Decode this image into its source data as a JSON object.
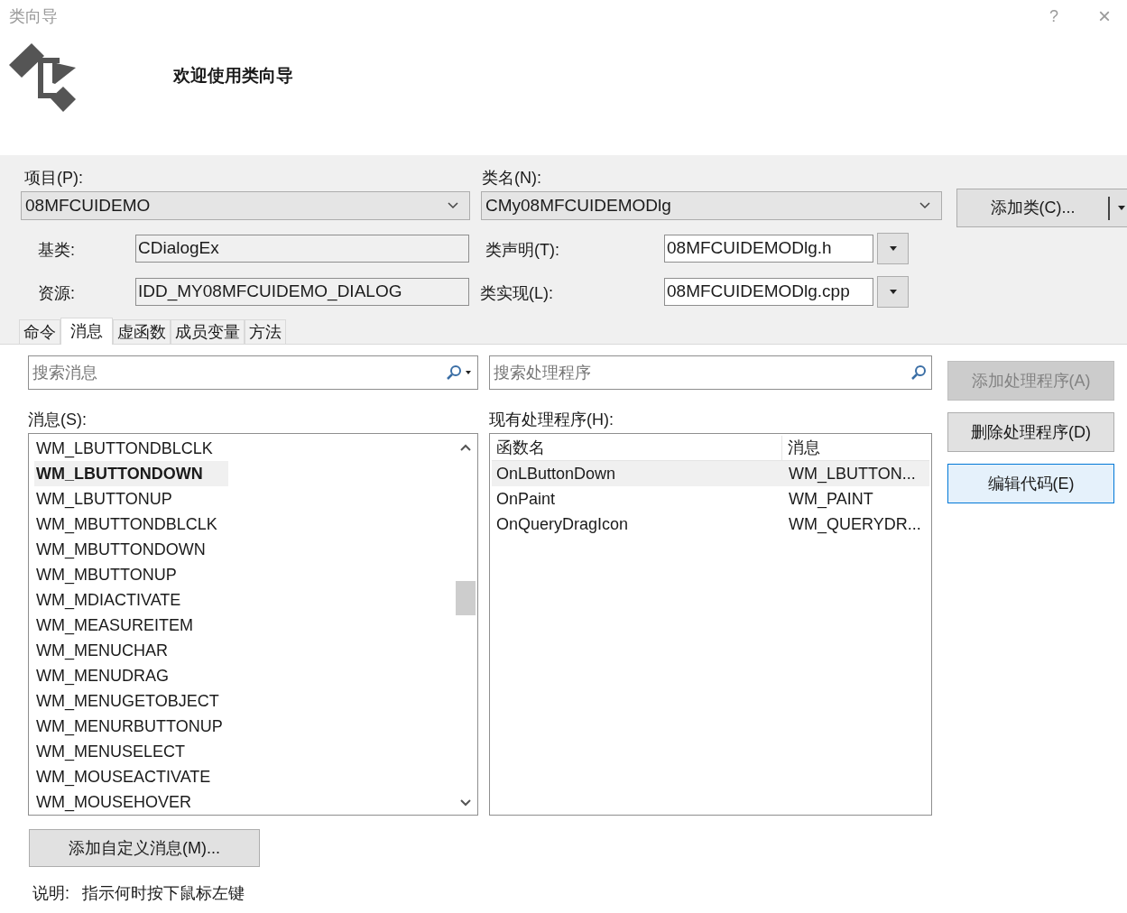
{
  "window": {
    "title": "类向导",
    "help": "?",
    "close": "×"
  },
  "header": {
    "welcome": "欢迎使用类向导"
  },
  "project": {
    "label": "项目(P):",
    "value": "08MFCUIDEMO"
  },
  "class_name": {
    "label": "类名(N):",
    "value": "CMy08MFCUIDEMODlg"
  },
  "add_class_button": {
    "label": "添加类(C)..."
  },
  "base_class": {
    "label": "基类:",
    "value": "CDialogEx"
  },
  "resource": {
    "label": "资源:",
    "value": "IDD_MY08MFCUIDEMO_DIALOG"
  },
  "class_declaration": {
    "label": "类声明(T):",
    "value": "08MFCUIDEMODlg.h"
  },
  "class_implementation": {
    "label": "类实现(L):",
    "value": "08MFCUIDEMODlg.cpp"
  },
  "tabs": [
    {
      "label": "命令",
      "selected": false
    },
    {
      "label": "消息",
      "selected": true
    },
    {
      "label": "虚函数",
      "selected": false
    },
    {
      "label": "成员变量",
      "selected": false
    },
    {
      "label": "方法",
      "selected": false
    }
  ],
  "message_search": {
    "placeholder": "搜索消息"
  },
  "handler_search": {
    "placeholder": "搜索处理程序"
  },
  "messages": {
    "label": "消息(S):",
    "items": [
      {
        "text": "WM_LBUTTONDBLCLK",
        "selected": false
      },
      {
        "text": "WM_LBUTTONDOWN",
        "selected": true
      },
      {
        "text": "WM_LBUTTONUP",
        "selected": false
      },
      {
        "text": "WM_MBUTTONDBLCLK",
        "selected": false
      },
      {
        "text": "WM_MBUTTONDOWN",
        "selected": false
      },
      {
        "text": "WM_MBUTTONUP",
        "selected": false
      },
      {
        "text": "WM_MDIACTIVATE",
        "selected": false
      },
      {
        "text": "WM_MEASUREITEM",
        "selected": false
      },
      {
        "text": "WM_MENUCHAR",
        "selected": false
      },
      {
        "text": "WM_MENUDRAG",
        "selected": false
      },
      {
        "text": "WM_MENUGETOBJECT",
        "selected": false
      },
      {
        "text": "WM_MENURBUTTONUP",
        "selected": false
      },
      {
        "text": "WM_MENUSELECT",
        "selected": false
      },
      {
        "text": "WM_MOUSEACTIVATE",
        "selected": false
      },
      {
        "text": "WM_MOUSEHOVER",
        "selected": false
      }
    ]
  },
  "handlers": {
    "label": "现有处理程序(H):",
    "columns": [
      "函数名",
      "消息"
    ],
    "rows": [
      {
        "cells": [
          "OnLButtonDown",
          "WM_LBUTTON..."
        ],
        "selected": true
      },
      {
        "cells": [
          "OnPaint",
          "WM_PAINT"
        ],
        "selected": false
      },
      {
        "cells": [
          "OnQueryDragIcon",
          "WM_QUERYDR..."
        ],
        "selected": false
      }
    ]
  },
  "actions": [
    {
      "label": "添加处理程序(A)",
      "disabled": true,
      "focused": false
    },
    {
      "label": "删除处理程序(D)",
      "disabled": false,
      "focused": false
    },
    {
      "label": "编辑代码(E)",
      "disabled": false,
      "focused": true
    }
  ],
  "add_custom_message_button": {
    "label": "添加自定义消息(M)..."
  },
  "description": {
    "label": "说明:",
    "text": "指示何时按下鼠标左键"
  }
}
